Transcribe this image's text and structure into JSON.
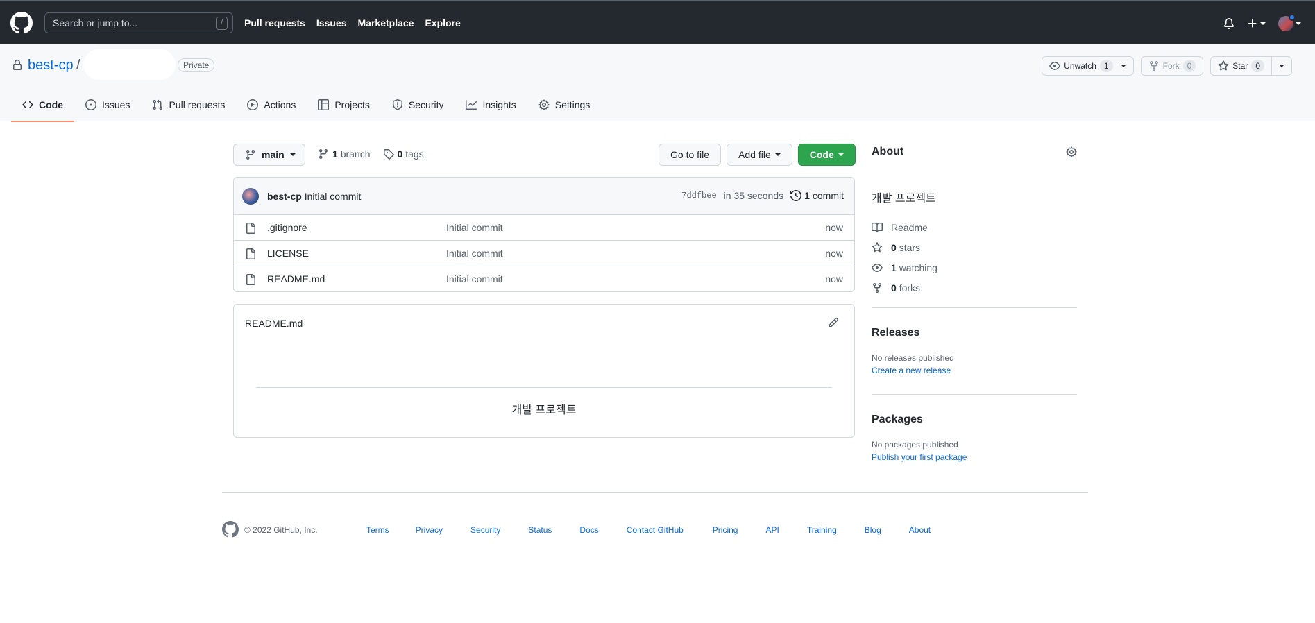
{
  "header": {
    "search_placeholder": "Search or jump to...",
    "search_shortcut": "/",
    "nav": [
      "Pull requests",
      "Issues",
      "Marketplace",
      "Explore"
    ]
  },
  "repo": {
    "owner": "best-cp",
    "separator": "/",
    "visibility": "Private",
    "watch_label": "Unwatch",
    "watch_count": "1",
    "fork_label": "Fork",
    "fork_count": "0",
    "star_label": "Star",
    "star_count": "0"
  },
  "tabs": [
    {
      "label": "Code",
      "icon": "code-icon",
      "active": true
    },
    {
      "label": "Issues",
      "icon": "issue-icon"
    },
    {
      "label": "Pull requests",
      "icon": "pull-request-icon"
    },
    {
      "label": "Actions",
      "icon": "play-icon"
    },
    {
      "label": "Projects",
      "icon": "table-icon"
    },
    {
      "label": "Security",
      "icon": "shield-icon"
    },
    {
      "label": "Insights",
      "icon": "graph-icon"
    },
    {
      "label": "Settings",
      "icon": "gear-icon"
    }
  ],
  "branch": {
    "current": "main",
    "branch_count": "1",
    "branch_word": "branch",
    "tag_count": "0",
    "tag_word": "tags"
  },
  "buttons": {
    "go_to_file": "Go to file",
    "add_file": "Add file",
    "code": "Code"
  },
  "last_commit": {
    "author": "best-cp",
    "message": "Initial commit",
    "sha": "7ddfbee",
    "time": "in 35 seconds",
    "commit_count": "1",
    "commit_word": "commit"
  },
  "files": [
    {
      "name": ".gitignore",
      "commit": "Initial commit",
      "age": "now"
    },
    {
      "name": "LICENSE",
      "commit": "Initial commit",
      "age": "now"
    },
    {
      "name": "README.md",
      "commit": "Initial commit",
      "age": "now"
    }
  ],
  "readme": {
    "title": "README.md",
    "body": "개발 프로젝트"
  },
  "about": {
    "heading": "About",
    "description": "개발 프로젝트",
    "readme": "Readme",
    "stars_count": "0",
    "stars_word": "stars",
    "watching_count": "1",
    "watching_word": "watching",
    "forks_count": "0",
    "forks_word": "forks"
  },
  "releases": {
    "heading": "Releases",
    "status": "No releases published",
    "link": "Create a new release"
  },
  "packages": {
    "heading": "Packages",
    "status": "No packages published",
    "link": "Publish your first package"
  },
  "footer": {
    "copyright": "© 2022 GitHub, Inc.",
    "links": [
      "Terms",
      "Privacy",
      "Security",
      "Status",
      "Docs",
      "Contact GitHub",
      "Pricing",
      "API",
      "Training",
      "Blog",
      "About"
    ]
  },
  "colors": {
    "header_bg": "#24292f",
    "link": "#0969da",
    "primary_button": "#2da44e",
    "active_tab_underline": "#fd8c73"
  }
}
